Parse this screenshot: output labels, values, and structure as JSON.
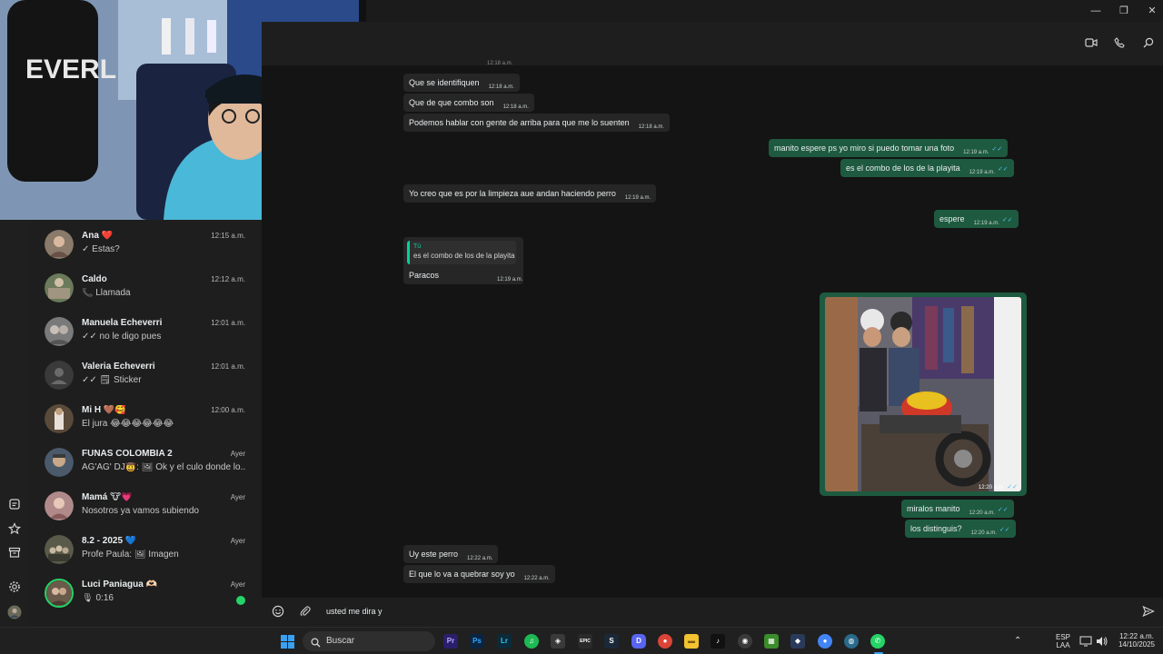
{
  "window": {
    "controls": {
      "minimize": "—",
      "maximize": "❐",
      "close": "✕"
    }
  },
  "rail": {
    "icons": [
      "status-icon",
      "starred-icon",
      "archive-icon",
      "settings-icon",
      "profile-icon"
    ]
  },
  "chat_list": {
    "items": [
      {
        "name": "Ana ❤️",
        "preview": "✓ Estas?",
        "time": "12:15 a.m.",
        "avatar_color": "#8a7a6a"
      },
      {
        "name": "Caldo",
        "preview": "📞 Llamada",
        "time": "12:12 a.m.",
        "avatar_color": "#6a7a5a"
      },
      {
        "name": "Manuela Echeverri",
        "preview": "✓✓ no le digo pues",
        "time": "12:01 a.m.",
        "avatar_color": "#7a7a7a"
      },
      {
        "name": "Valeria Echeverri",
        "preview": "✓✓ 🗒 Sticker",
        "time": "12:01 a.m.",
        "avatar_color": "#3a3a3a"
      },
      {
        "name": "Mi H 🤎🥰",
        "preview": "El jura 😂😂😂😂😂😂",
        "time": "12:00 a.m.",
        "avatar_color": "#5a4a3a"
      },
      {
        "name": "FUNAS COLOMBIA 2",
        "preview": "AG'AG' DJ🤠: 🖼 Ok y el culo donde lo...",
        "time": "Ayer",
        "avatar_color": "#4a5a6a"
      },
      {
        "name": "Mamá 🐮💗",
        "preview": "Nosotros ya vamos subiendo",
        "time": "Ayer",
        "avatar_color": "#b08a8a"
      },
      {
        "name": "8.2 - 2025 💙",
        "preview": "Profe Paula: 🖼 Imagen",
        "time": "Ayer",
        "avatar_color": "#5a5a4a"
      },
      {
        "name": "Luci Paniagua 🫶🏻",
        "preview": "🎙 0:16",
        "time": "Ayer",
        "avatar_color": "#6a5a4a",
        "unread": true
      }
    ]
  },
  "conversation": {
    "header_icons": [
      "video-call-icon",
      "voice-call-icon",
      "search-icon"
    ],
    "partial_time": "12:18 a.m.",
    "messages": [
      {
        "dir": "in",
        "text": "Que se identifiquen",
        "time": "12:18 a.m."
      },
      {
        "dir": "in",
        "text": "Que de que combo son",
        "time": "12:18 a.m."
      },
      {
        "dir": "in",
        "text": "Podemos hablar con gente de arriba para que me lo suenten",
        "time": "12:18 a.m."
      },
      {
        "dir": "out",
        "text": "manito espere ps yo miro si puedo tomar una foto",
        "time": "12:19 a.m."
      },
      {
        "dir": "out",
        "text": "es el combo de los de la playita",
        "time": "12:19 a.m."
      },
      {
        "dir": "in",
        "text": "Yo creo que es por la limpieza aue andan haciendo perro",
        "time": "12:19 a.m."
      },
      {
        "dir": "out",
        "text": "espere",
        "time": "12:19 a.m."
      },
      {
        "dir": "in",
        "text": "Paracos",
        "time": "12:19 a.m.",
        "quote_author": "Tú",
        "quote_text": "es el combo de los de la playita"
      },
      {
        "dir": "out",
        "type": "image",
        "time": "12:20 a.m."
      },
      {
        "dir": "out",
        "text": "miralos manito",
        "time": "12:20 a.m."
      },
      {
        "dir": "out",
        "text": "los distinguis?",
        "time": "12:20 a.m."
      },
      {
        "dir": "in",
        "text": "Uy este perro",
        "time": "12:22 a.m."
      },
      {
        "dir": "in",
        "text": "El que lo va a quebrar soy yo",
        "time": "12:22 a.m."
      }
    ],
    "ticks": "✓✓",
    "compose_text": "usted me dira y"
  },
  "taskbar": {
    "search_label": "Buscar",
    "apps": [
      {
        "name": "premiere-icon",
        "label": "Pr",
        "color": "#2a1f6b"
      },
      {
        "name": "photoshop-icon",
        "label": "Ps",
        "color": "#0b2440"
      },
      {
        "name": "lightroom-icon",
        "label": "Lr",
        "color": "#0b2a3a"
      },
      {
        "name": "spotify-icon",
        "label": "♫",
        "color": "#1db954"
      },
      {
        "name": "app-icon",
        "label": "◈",
        "color": "#3a3a3a"
      },
      {
        "name": "epic-games-icon",
        "label": "EPIC",
        "color": "#2a2a2a"
      },
      {
        "name": "steam-icon",
        "label": "S",
        "color": "#1b2838"
      },
      {
        "name": "discord-icon",
        "label": "D",
        "color": "#5865f2"
      },
      {
        "name": "chrome-icon",
        "label": "●",
        "color": "#db4437"
      },
      {
        "name": "file-explorer-icon",
        "label": "▬",
        "color": "#f2c230"
      },
      {
        "name": "tiktok-icon",
        "label": "♪",
        "color": "#111111"
      },
      {
        "name": "obs-icon",
        "label": "◉",
        "color": "#3a3a3a"
      },
      {
        "name": "minecraft-icon",
        "label": "▦",
        "color": "#3b8c2a"
      },
      {
        "name": "app2-icon",
        "label": "◆",
        "color": "#2a3a5a"
      },
      {
        "name": "chrome2-icon",
        "label": "●",
        "color": "#4285f4"
      },
      {
        "name": "browser-icon",
        "label": "◍",
        "color": "#2a6a8a"
      },
      {
        "name": "whatsapp-icon",
        "label": "✆",
        "color": "#25d366"
      }
    ],
    "lang_top": "ESP",
    "lang_bottom": "LAA",
    "clock_time": "12:22 a.m.",
    "clock_date": "14/10/2025"
  }
}
